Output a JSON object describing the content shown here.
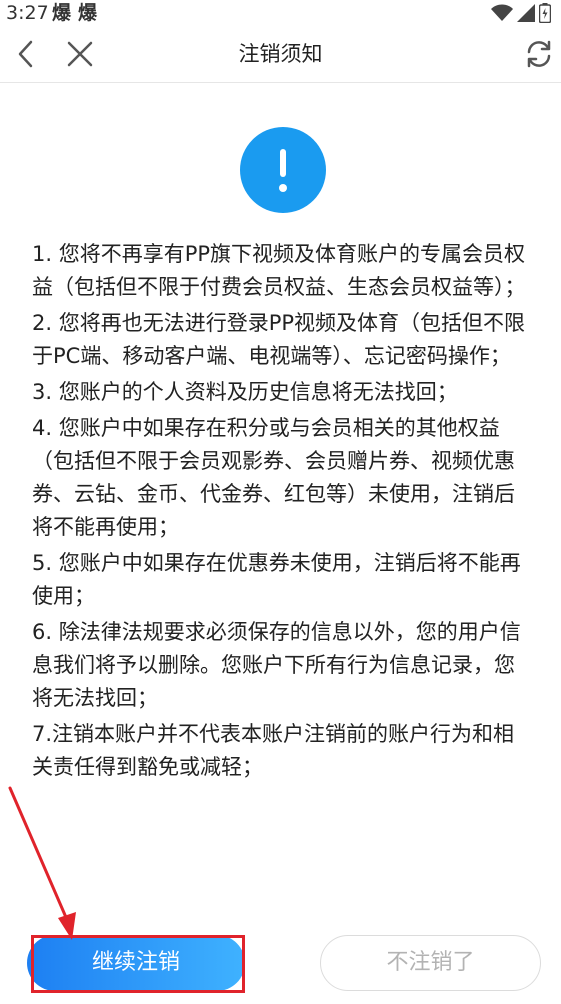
{
  "status_bar": {
    "time": "3:27",
    "notifications": [
      "爆",
      "爆"
    ],
    "icons": [
      "wifi-icon",
      "signal-icon",
      "battery-icon"
    ]
  },
  "header": {
    "title": "注销须知",
    "back_icon": "back-arrow-icon",
    "close_icon": "close-icon",
    "refresh_icon": "refresh-icon"
  },
  "alert": {
    "icon": "exclamation-icon",
    "color": "#1a9bf0"
  },
  "terms": [
    "1. 您将不再享有PP旗下视频及体育账户的专属会员权益（包括但不限于付费会员权益、生态会员权益等）；",
    "2. 您将再也无法进行登录PP视频及体育（包括但不限于PC端、移动客户端、电视端等）、忘记密码操作；",
    "3. 您账户的个人资料及历史信息将无法找回；",
    "4. 您账户中如果存在积分或与会员相关的其他权益（包括但不限于会员观影券、会员赠片券、视频优惠券、云钻、金币、代金券、红包等）未使用，注销后将不能再使用；",
    "5. 您账户中如果存在优惠券未使用，注销后将不能再使用；",
    "6. 除法律法规要求必须保存的信息以外，您的用户信息我们将予以删除。您账户下所有行为信息记录，您将无法找回；",
    "7.注销本账户并不代表本账户注销前的账户行为和相关责任得到豁免或减轻；"
  ],
  "buttons": {
    "continue_label": "继续注销",
    "cancel_label": "不注销了"
  },
  "colors": {
    "accent": "#1a9bf0",
    "annotation": "#e0232b"
  }
}
